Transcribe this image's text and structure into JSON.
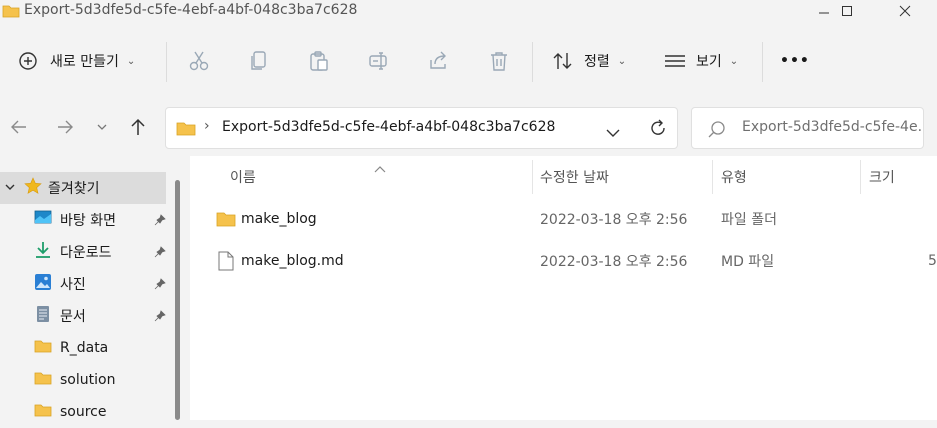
{
  "window": {
    "title": "Export-5d3dfe5d-c5fe-4ebf-a4bf-048c3ba7c628",
    "icons": [
      "folder-icon",
      "minimize-icon",
      "maximize-icon",
      "close-icon"
    ]
  },
  "toolbar": {
    "new_label": "새로 만들기",
    "sort_label": "정렬",
    "view_label": "보기",
    "more_label": "•••",
    "icons": [
      "new-icon",
      "cut-icon",
      "copy-icon",
      "paste-icon",
      "rename-icon",
      "share-icon",
      "delete-icon",
      "sort-icon",
      "view-icon"
    ]
  },
  "address": {
    "path": "Export-5d3dfe5d-c5fe-4ebf-a4bf-048c3ba7c628",
    "search_placeholder": "Export-5d3dfe5d-c5fe-4e..."
  },
  "sidebar": {
    "items": [
      {
        "label": "즐겨찾기",
        "icon": "star-icon"
      },
      {
        "label": "바탕 화면",
        "icon": "desktop-icon"
      },
      {
        "label": "다운로드",
        "icon": "download-icon"
      },
      {
        "label": "사진",
        "icon": "pictures-icon"
      },
      {
        "label": "문서",
        "icon": "documents-icon"
      },
      {
        "label": "R_data",
        "icon": "folder-icon"
      },
      {
        "label": "solution",
        "icon": "folder-icon"
      },
      {
        "label": "source",
        "icon": "folder-icon"
      }
    ]
  },
  "files": {
    "columns": [
      "이름",
      "수정한 날짜",
      "유형",
      "크기"
    ],
    "rows": [
      {
        "name": "make_blog",
        "modified": "2022-03-18 오후 2:56",
        "type": "파일 폴더",
        "size": "",
        "icon": "folder-icon"
      },
      {
        "name": "make_blog.md",
        "modified": "2022-03-18 오후 2:56",
        "type": "MD 파일",
        "size": "5",
        "icon": "file-icon"
      }
    ]
  },
  "colors": {
    "background": "#f3f3f3",
    "content": "#ffffff",
    "selected": "#dcdcdc",
    "folder": "#f5c24c",
    "accent": "#0078d4"
  }
}
